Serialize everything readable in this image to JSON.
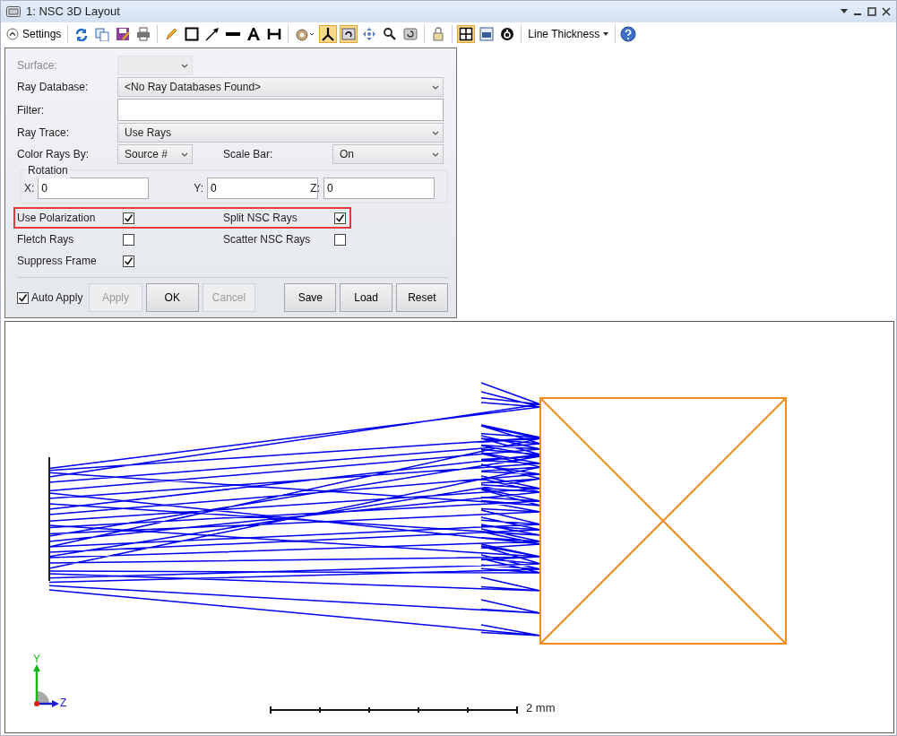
{
  "window": {
    "title": "1: NSC 3D Layout"
  },
  "toolbar": {
    "settings_label": "Settings",
    "line_thickness_label": "Line Thickness",
    "tools": [
      {
        "selected": false
      },
      {
        "selected": false
      },
      {
        "selected": false
      },
      {
        "selected": false
      },
      {
        "selected": false
      },
      {
        "selected": false
      },
      {
        "selected": false
      },
      {
        "selected": false
      },
      {
        "selected": false
      },
      {
        "selected": false
      },
      {
        "selected": false
      },
      {
        "selected": true
      },
      {
        "selected": true
      },
      {
        "selected": false
      },
      {
        "selected": false
      },
      {
        "selected": false
      },
      {
        "selected": false
      },
      {
        "selected": true
      },
      {
        "selected": false
      },
      {
        "selected": false
      }
    ]
  },
  "settings": {
    "surface": {
      "label": "Surface:",
      "disabled": true
    },
    "ray_database": {
      "label": "Ray Database:",
      "value": "<No Ray Databases Found>"
    },
    "filter": {
      "label": "Filter:"
    },
    "ray_trace": {
      "label": "Ray Trace:",
      "value": "Use Rays"
    },
    "color_rays_by": {
      "label": "Color Rays By:",
      "value": "Source #"
    },
    "scale_bar": {
      "label": "Scale Bar:",
      "value": "On"
    },
    "rotation": {
      "title": "Rotation",
      "axes": [
        {
          "label": "X:",
          "value": "0"
        },
        {
          "label": "Y:",
          "value": "0"
        },
        {
          "label": "Z:",
          "value": "0"
        }
      ]
    },
    "checkbox_rows": [
      {
        "highlighted": true,
        "items": [
          {
            "label": "Use Polarization",
            "checked": true
          },
          {
            "label": "Split NSC Rays",
            "checked": true
          }
        ]
      },
      {
        "highlighted": false,
        "items": [
          {
            "label": "Fletch Rays",
            "checked": false
          },
          {
            "label": "Scatter NSC Rays",
            "checked": false
          }
        ]
      },
      {
        "highlighted": false,
        "items": [
          {
            "label": "Suppress Frame",
            "checked": true
          }
        ]
      }
    ],
    "auto_apply": {
      "label": "Auto Apply",
      "checked": true
    },
    "buttons": [
      {
        "label": "Apply",
        "disabled": true
      },
      {
        "label": "OK",
        "disabled": false
      },
      {
        "label": "Cancel",
        "disabled": true
      },
      {
        "label": "Save",
        "disabled": false
      },
      {
        "label": "Load",
        "disabled": false
      },
      {
        "label": "Reset",
        "disabled": false
      }
    ]
  },
  "viewport": {
    "axes": {
      "y_label": "Y",
      "z_label": "Z"
    },
    "scale_bar": {
      "label": "2 mm"
    }
  }
}
